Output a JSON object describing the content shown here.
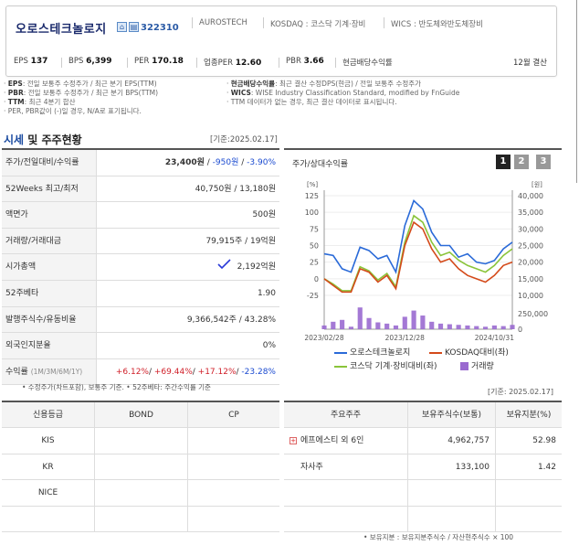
{
  "header": {
    "company_name": "오로스테크놀로지",
    "code": "322310",
    "english_name": "AUROSTECH",
    "market": "KOSDAQ : 코스닥 기계·장비",
    "wics": "WICS : 반도체와반도체장비",
    "stats": [
      {
        "label": "EPS",
        "value": "137"
      },
      {
        "label": "BPS",
        "value": "6,399"
      },
      {
        "label": "PER",
        "value": "170.18"
      },
      {
        "label": "업종PER",
        "value": "12.60"
      },
      {
        "label": "PBR",
        "value": "3.66"
      },
      {
        "label": "현금배당수익률",
        "value": ""
      }
    ],
    "fiscal": "12월 결산"
  },
  "notes": {
    "left": [
      {
        "b": "EPS",
        "t": ": 전일 보통주 수정주가 / 최근 분기 EPS(TTM)"
      },
      {
        "b": "PBR",
        "t": ": 전일 보통주 수정주가 / 최근 분기 BPS(TTM)"
      },
      {
        "b": "TTM",
        "t": ": 최근 4분기 합산"
      },
      {
        "b": "",
        "t": "PER, PBR값이 (-)일 경우, N/A로 표기됩니다."
      }
    ],
    "right": [
      {
        "b": "현금배당수익률",
        "t": ": 최근 결산 수정DPS(현금) / 전일 보통주 수정주가"
      },
      {
        "b": "WICS",
        "t": ": WISE Industry Classification Standard, modified by FnGuide"
      },
      {
        "b": "",
        "t": "TTM 데이터가 없는 경우, 최근 결산 데이터로 표시됩니다."
      }
    ]
  },
  "market_section": {
    "title_a": "시세",
    "title_b": " 및 주주현황",
    "ref_date": "[기준:2025.02.17]",
    "rows": [
      {
        "label": "주가/전일대비/수익률",
        "v1": "23,400원",
        "v2": "-950원",
        "v3": "-3.90%"
      },
      {
        "label": "52Weeks 최고/최저",
        "value": "40,750원 / 13,180원"
      },
      {
        "label": "액면가",
        "value": "500원"
      },
      {
        "label": "거래량/거래대금",
        "value": "79,915주 / 19억원"
      },
      {
        "label": "시가총액",
        "value": "2,192억원"
      },
      {
        "label": "52주베타",
        "value": "1.90"
      },
      {
        "label": "발행주식수/유동비율",
        "value": "9,366,542주 / 43.28%"
      },
      {
        "label": "외국인지분율",
        "value": "0%"
      },
      {
        "label": "수익률",
        "label_sub": "(1M/3M/6M/1Y)",
        "r1": "+6.12%",
        "r2": "+69.44%",
        "r3": "+17.12%",
        "r4": "-23.28%"
      }
    ],
    "footnote": "• 수정주가(차트포함), 보통주 기준. • 52주베타: 주간수익률 기준"
  },
  "chart": {
    "title": "주가/상대수익률",
    "pages": [
      "1",
      "2",
      "3"
    ],
    "left_unit": "[%]",
    "right_unit": "[원]",
    "left_ticks": [
      "125",
      "100",
      "75",
      "50",
      "25",
      "0",
      "-25"
    ],
    "right_ticks": [
      "40,000",
      "35,000",
      "30,000",
      "25,000",
      "20,000",
      "15,000",
      "10,000"
    ],
    "vol_ticks": [
      "250,000",
      "0"
    ],
    "x_ticks": [
      "2023/02/28",
      "2023/12/28",
      "2024/10/31"
    ],
    "legend": [
      {
        "name": "오로스테크놀로지",
        "color": "#2a6ad8"
      },
      {
        "name": "KOSDAQ대비(좌)",
        "color": "#d44a1a"
      },
      {
        "name": "코스닥 기계·장비대비(좌)",
        "color": "#8ac43a"
      },
      {
        "name": "거래량",
        "color": "#9a6ad0"
      }
    ]
  },
  "chart_data": {
    "type": "line",
    "x": [
      "2023/02/28",
      "2023/04",
      "2023/05",
      "2023/06",
      "2023/07",
      "2023/08",
      "2023/09",
      "2023/10",
      "2023/11",
      "2023/12/28",
      "2024/01",
      "2024/02",
      "2024/03",
      "2024/04",
      "2024/05",
      "2024/06",
      "2024/07",
      "2024/08",
      "2024/09",
      "2024/10/31",
      "2024/12",
      "2025/02"
    ],
    "series": [
      {
        "name": "오로스테크놀로지",
        "axis": "right",
        "values": [
          22500,
          22000,
          18000,
          17000,
          24500,
          23500,
          21000,
          22000,
          17000,
          31000,
          38500,
          36000,
          29000,
          25000,
          25000,
          21500,
          22500,
          20000,
          19500,
          20500,
          24000,
          26000
        ]
      },
      {
        "name": "KOSDAQ대비(좌)",
        "axis": "left",
        "values": [
          0,
          -10,
          -20,
          -20,
          15,
          10,
          -5,
          5,
          -15,
          50,
          85,
          75,
          45,
          25,
          30,
          15,
          5,
          0,
          -5,
          5,
          20,
          25
        ]
      },
      {
        "name": "코스닥 기계·장비대비(좌)",
        "axis": "left",
        "values": [
          0,
          -8,
          -18,
          -18,
          18,
          12,
          -2,
          8,
          -12,
          55,
          95,
          85,
          55,
          35,
          40,
          28,
          20,
          15,
          10,
          20,
          35,
          45
        ]
      },
      {
        "name": "거래량",
        "axis": "volume",
        "values": [
          60000,
          120000,
          150000,
          40000,
          350000,
          180000,
          110000,
          90000,
          60000,
          200000,
          300000,
          220000,
          120000,
          90000,
          80000,
          70000,
          60000,
          50000,
          40000,
          60000,
          50000,
          70000
        ]
      }
    ],
    "ylim_left": [
      -25,
      125
    ],
    "ylim_right": [
      10000,
      40000
    ]
  },
  "credit": {
    "headers": [
      "신용등급",
      "BOND",
      "CP"
    ],
    "rows": [
      [
        "KIS",
        "",
        ""
      ],
      [
        "KR",
        "",
        ""
      ],
      [
        "NICE",
        "",
        ""
      ],
      [
        "",
        "",
        ""
      ]
    ]
  },
  "holders": {
    "ref_date": "[기준: 2025.02.17]",
    "headers": [
      "주요주주",
      "보유주식수(보통)",
      "보유지분(%)"
    ],
    "rows": [
      {
        "name": "에프에스티 외 6인",
        "shares": "4,962,757",
        "pct": "52.98",
        "expand": "+"
      },
      {
        "name": "자사주",
        "shares": "133,100",
        "pct": "1.42",
        "expand": ""
      },
      {
        "name": "",
        "shares": "",
        "pct": "",
        "expand": ""
      },
      {
        "name": "",
        "shares": "",
        "pct": "",
        "expand": ""
      }
    ],
    "footnote": "• 보유지분 : 보유지분주식수 / 자산현주식수 × 100"
  }
}
